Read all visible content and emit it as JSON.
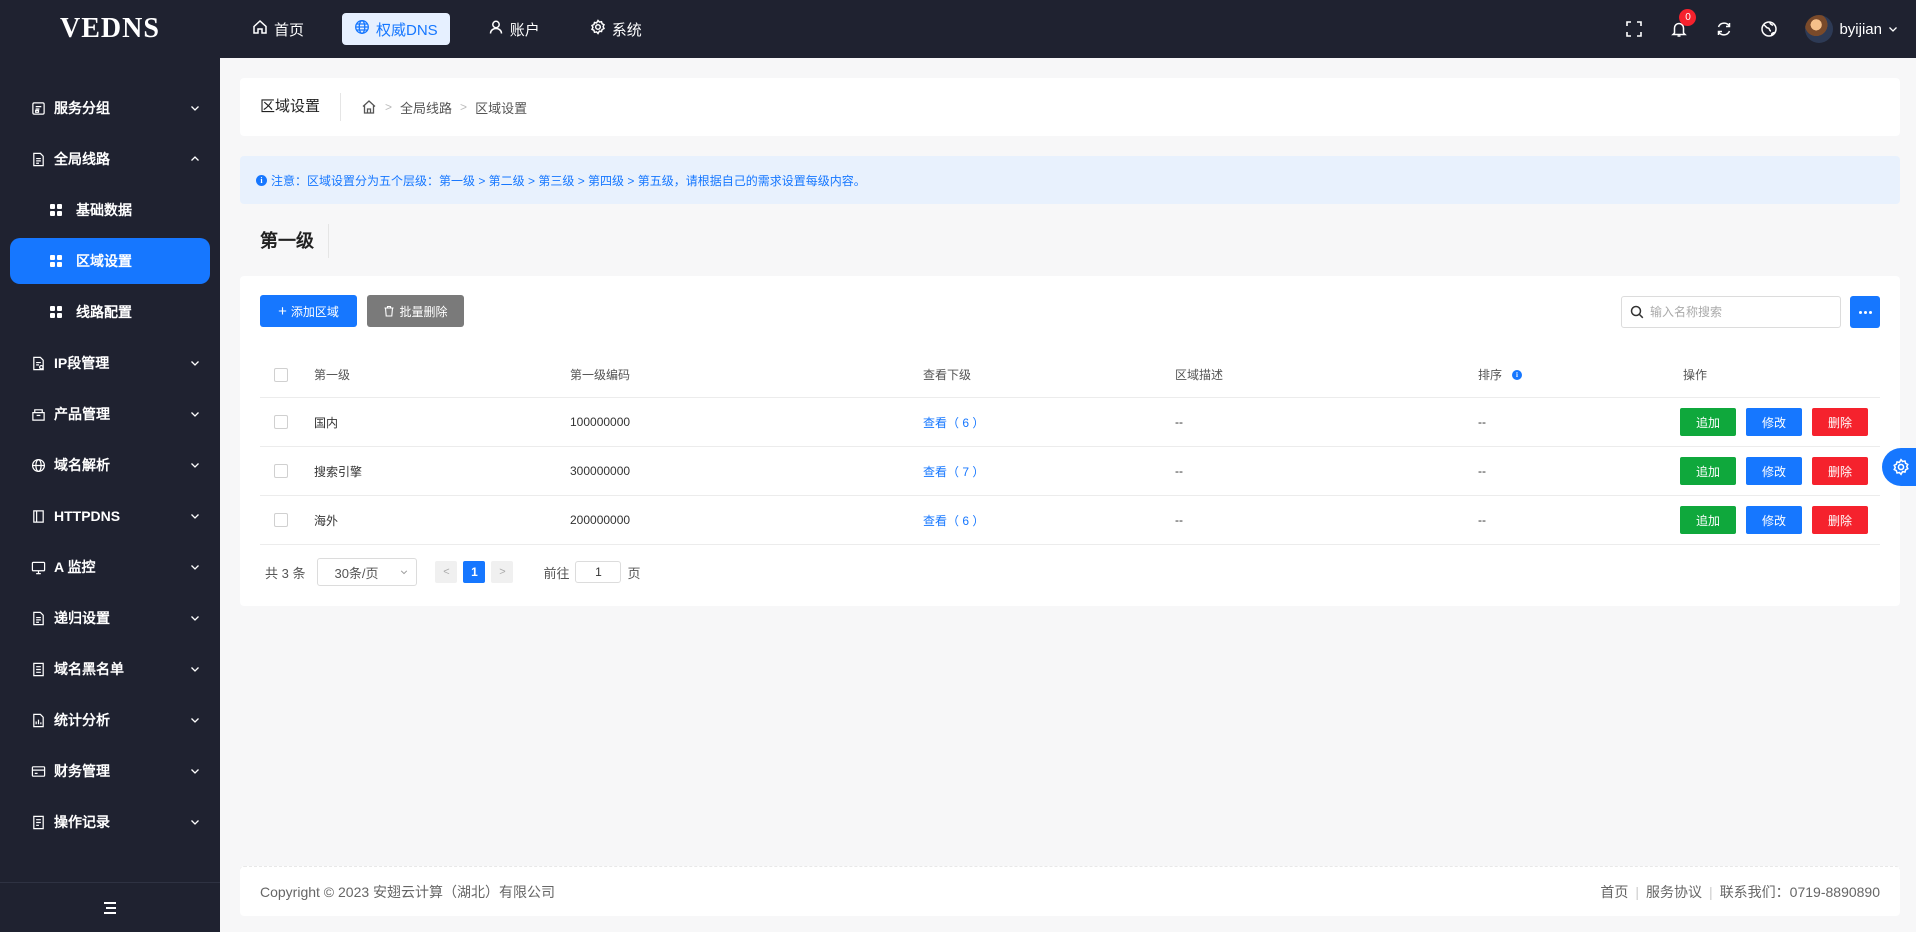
{
  "app": {
    "logo": "VEDNS"
  },
  "topnav": [
    {
      "label": "首页",
      "icon": "home-icon"
    },
    {
      "label": "权威DNS",
      "icon": "globe-icon",
      "active": true
    },
    {
      "label": "账户",
      "icon": "user-icon"
    },
    {
      "label": "系统",
      "icon": "gear-icon"
    }
  ],
  "header": {
    "notification_count": "0",
    "username": "byijian"
  },
  "sidebar": {
    "items": [
      {
        "label": "服务分组",
        "icon": "group-icon"
      },
      {
        "label": "全局线路",
        "icon": "route-icon",
        "expanded": true
      },
      {
        "label": "基础数据"
      },
      {
        "label": "区域设置",
        "active": true
      },
      {
        "label": "线路配置"
      },
      {
        "label": "IP段管理",
        "icon": "ip-icon"
      },
      {
        "label": "产品管理",
        "icon": "product-icon"
      },
      {
        "label": "域名解析",
        "icon": "domain-icon"
      },
      {
        "label": "HTTPDNS",
        "icon": "httpdns-icon"
      },
      {
        "label": "A 监控",
        "icon": "monitor-icon"
      },
      {
        "label": "递归设置",
        "icon": "recursive-icon"
      },
      {
        "label": "域名黑名单",
        "icon": "blacklist-icon"
      },
      {
        "label": "统计分析",
        "icon": "stats-icon"
      },
      {
        "label": "财务管理",
        "icon": "finance-icon"
      },
      {
        "label": "操作记录",
        "icon": "log-icon"
      }
    ]
  },
  "breadcrumb": {
    "title": "区域设置",
    "items": [
      "全局线路",
      "区域设置"
    ]
  },
  "notice": {
    "text": "注意：区域设置分为五个层级：第一级 > 第二级 > 第三级 > 第四级 > 第五级，请根据自己的需求设置每级内容。"
  },
  "section": {
    "title": "第一级"
  },
  "toolbar": {
    "add_label": "添加区域",
    "batch_delete_label": "批量删除",
    "search_placeholder": "输入名称搜索"
  },
  "table": {
    "columns": [
      "第一级",
      "第一级编码",
      "查看下级",
      "区域描述",
      "排序",
      "操作"
    ],
    "rows": [
      {
        "name": "国内",
        "code": "100000000",
        "view": "查看（ 6 ）",
        "desc": "--",
        "sort": "--"
      },
      {
        "name": "搜索引擎",
        "code": "300000000",
        "view": "查看（ 7 ）",
        "desc": "--",
        "sort": "--"
      },
      {
        "name": "海外",
        "code": "200000000",
        "view": "查看（ 6 ）",
        "desc": "--",
        "sort": "--"
      }
    ],
    "actions": {
      "add": "追加",
      "edit": "修改",
      "delete": "删除"
    }
  },
  "pagination": {
    "total": "共 3 条",
    "page_size": "30条/页",
    "current_page": "1",
    "goto_label": "前往",
    "goto_value": "1",
    "page_suffix": "页"
  },
  "footer": {
    "copyright": "Copyright © 2023 安翅云计算（湖北）有限公司",
    "links": [
      "首页",
      "服务协议",
      "联系我们：0719-8890890"
    ]
  },
  "colors": {
    "accent": "#1677ff",
    "add": "#0fa83c",
    "delete": "#f5222d",
    "sidebar_bg": "#1f2230"
  }
}
